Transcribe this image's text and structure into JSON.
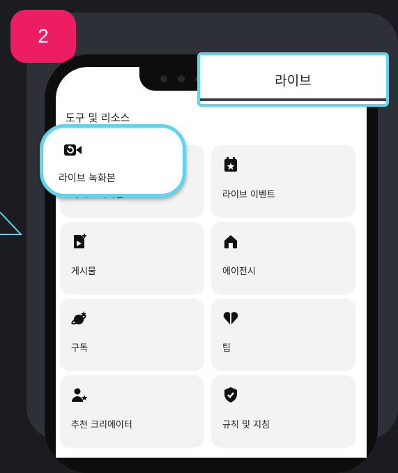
{
  "step": {
    "number": "2"
  },
  "screen": {
    "title_partial": "도"
  },
  "section": {
    "title": "도구 및 리소스"
  },
  "tiles": [
    {
      "label": "라이브 녹화본",
      "icon": "video-replay-icon"
    },
    {
      "label": "라이브 이벤트",
      "icon": "calendar-star-icon"
    },
    {
      "label": "게시물",
      "icon": "post-add-icon"
    },
    {
      "label": "에이전시",
      "icon": "home-icon"
    },
    {
      "label": "구독",
      "icon": "planet-star-icon"
    },
    {
      "label": "팀",
      "icon": "heart-split-icon"
    },
    {
      "label": "추천 크리에이터",
      "icon": "person-star-icon"
    },
    {
      "label": "규칙 및 지침",
      "icon": "shield-check-icon"
    }
  ],
  "callouts": {
    "tab_label": "라이브",
    "tile_label": "라이브 녹화본"
  },
  "colors": {
    "background": "#1b1c21",
    "card": "#2d3036",
    "badge": "#ec1d63",
    "highlight": "#5ed5ee"
  }
}
